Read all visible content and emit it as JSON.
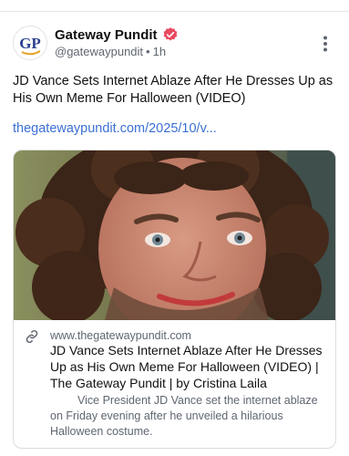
{
  "post": {
    "author": {
      "name": "Gateway Pundit",
      "handle": "@gatewaypundit",
      "time": "1h",
      "avatar_text": "GP",
      "verified": true,
      "verified_color": "#e84a5f"
    },
    "text": "JD Vance Sets Internet Ablaze After He Dresses Up as His Own Meme For Halloween (VIDEO)",
    "link_text": "thegatewaypundit.com/2025/10/v...",
    "link_color": "#3b6fd4"
  },
  "card": {
    "domain": "www.thegatewaypundit.com",
    "title": "JD Vance Sets Internet Ablaze After He Dresses Up as His Own Meme For Halloween (VIDEO) | The Gateway Pundit | by Cristina Laila",
    "description": "Vice President JD Vance set the internet ablaze on Friday evening after he unveiled a hilarious Halloween costume.",
    "link_icon": "link-icon",
    "image_alt": "close-up photo of a smiling man wearing a curly wig"
  },
  "icons": {
    "more": "more-vertical-icon",
    "verified": "verified-badge-icon"
  }
}
